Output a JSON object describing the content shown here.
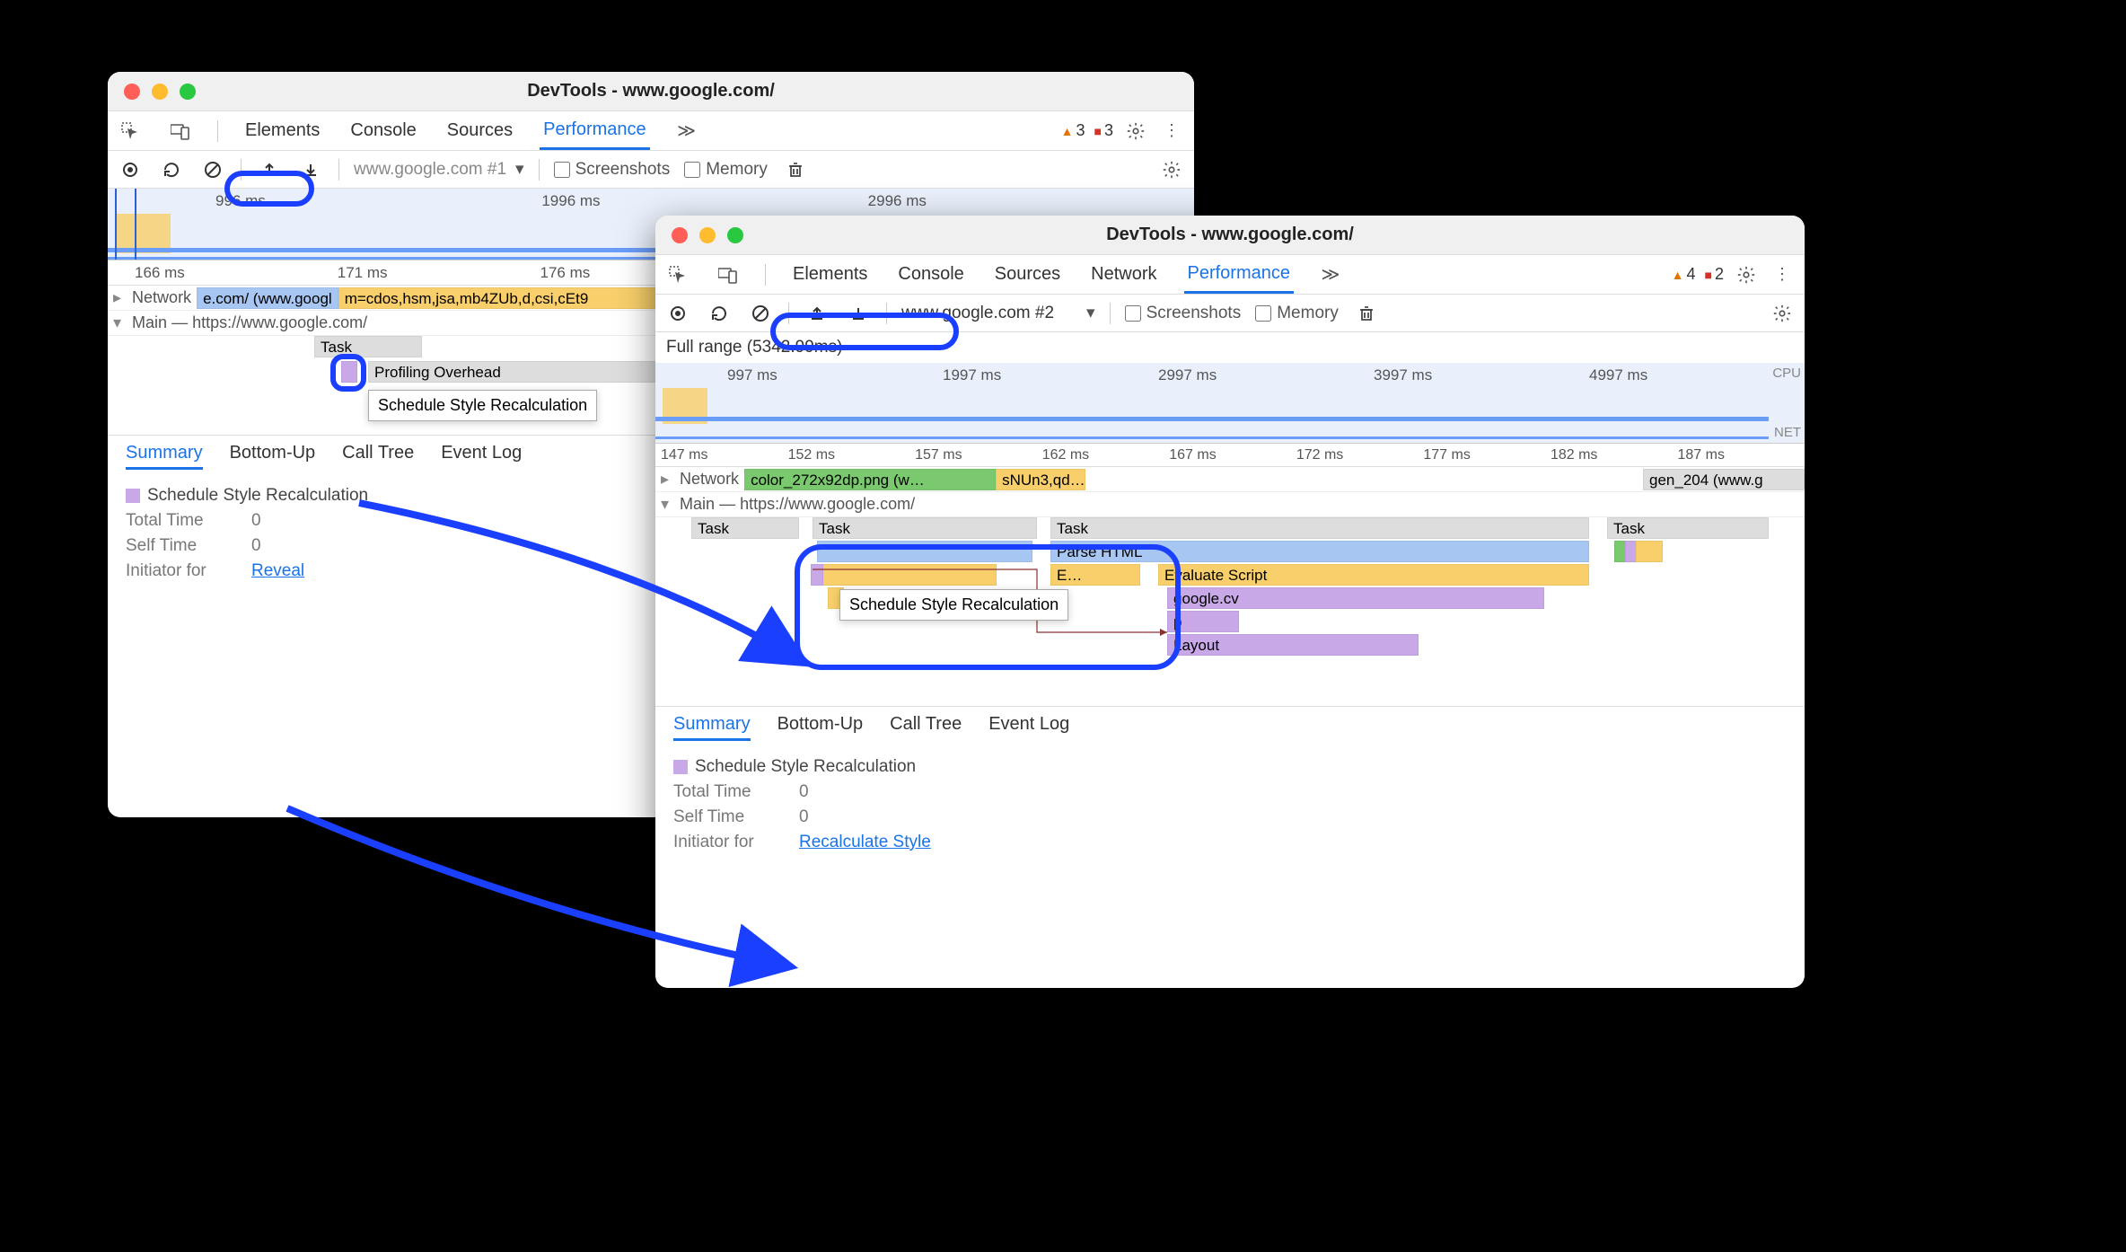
{
  "window1": {
    "title": "DevTools - www.google.com/",
    "tabs": [
      "Elements",
      "Console",
      "Sources",
      "Performance"
    ],
    "activeTab": 3,
    "warnCount": "3",
    "errCount": "3",
    "toolbar": {
      "target": "www.google.com #1",
      "screenshots": "Screenshots",
      "memory": "Memory"
    },
    "overviewTicks": [
      "996 ms",
      "1996 ms",
      "2996 ms"
    ],
    "timelineTicks": [
      "166 ms",
      "171 ms",
      "176 ms"
    ],
    "networkRow": "Network",
    "netA": "e.com/ (www.googl",
    "netB": "m=cdos,hsm,jsa,mb4ZUb,d,csi,cEt9",
    "mainRow": "Main — https://www.google.com/",
    "task": "Task",
    "prof": "Profiling Overhead",
    "tooltip": "Schedule Style Recalculation",
    "detailTabs": [
      "Summary",
      "Bottom-Up",
      "Call Tree",
      "Event Log"
    ],
    "summaryTitle": "Schedule Style Recalculation",
    "totalTimeLabel": "Total Time",
    "totalTime": "0",
    "selfTimeLabel": "Self Time",
    "selfTime": "0",
    "initiatorLabel": "Initiator for",
    "reveal": "Reveal"
  },
  "window2": {
    "title": "DevTools - www.google.com/",
    "tabs": [
      "Elements",
      "Console",
      "Sources",
      "Network",
      "Performance"
    ],
    "activeTab": 4,
    "warnCount": "4",
    "errCount": "2",
    "toolbar": {
      "target": "www.google.com #2",
      "screenshots": "Screenshots",
      "memory": "Memory"
    },
    "fullRange": "Full range (5342.99ms)",
    "overviewTicks": [
      "997 ms",
      "1997 ms",
      "2997 ms",
      "3997 ms",
      "4997 ms"
    ],
    "cpuLabel": "CPU",
    "netLabel": "NET",
    "timelineTicks": [
      "147 ms",
      "152 ms",
      "157 ms",
      "162 ms",
      "167 ms",
      "172 ms",
      "177 ms",
      "182 ms",
      "187 ms"
    ],
    "networkRow": "Network",
    "netA": "color_272x92dp.png (w…",
    "netB": "sNUn3,qd…",
    "netC": "gen_204 (www.g",
    "mainRow": "Main — https://www.google.com/",
    "task": "Task",
    "parse": "Parse HTML",
    "e": "E…",
    "eval": "Evaluate Script",
    "gcv": "google.cv",
    "p": "p",
    "layout": "Layout",
    "tooltip": "Schedule Style Recalculation",
    "detailTabs": [
      "Summary",
      "Bottom-Up",
      "Call Tree",
      "Event Log"
    ],
    "summaryTitle": "Schedule Style Recalculation",
    "totalTimeLabel": "Total Time",
    "totalTime": "0",
    "selfTimeLabel": "Self Time",
    "selfTime": "0",
    "initiatorLabel": "Initiator for",
    "reveal": "Recalculate Style"
  }
}
